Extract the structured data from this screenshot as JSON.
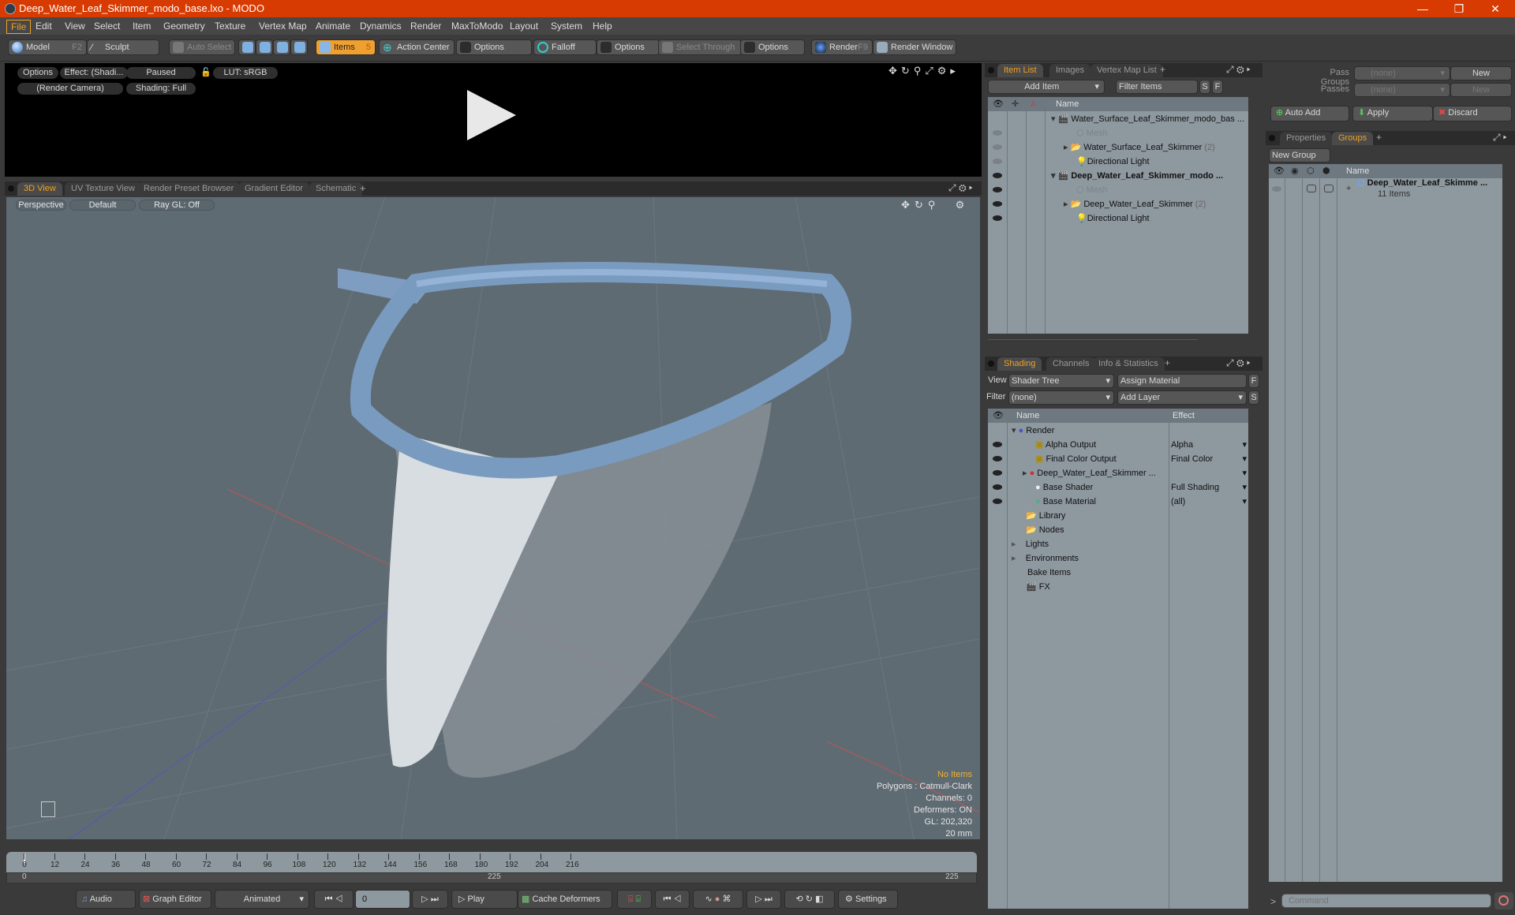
{
  "window": {
    "title": "Deep_Water_Leaf_Skimmer_modo_base.lxo - MODO",
    "minimize": "—",
    "restore": "❐",
    "close": "✕"
  },
  "menu": [
    "File",
    "Edit",
    "View",
    "Select",
    "Item",
    "Geometry",
    "Texture",
    "Vertex Map",
    "Animate",
    "Dynamics",
    "Render",
    "MaxToModo",
    "Layout",
    "System",
    "Help"
  ],
  "toolbar": {
    "model": "Model",
    "model_key": "F2",
    "sculpt": "Sculpt",
    "auto_select": "Auto Select",
    "items": "Items",
    "items_key": "5",
    "action_center": "Action Center",
    "options1": "Options",
    "falloff": "Falloff",
    "options2": "Options",
    "select_through": "Select Through",
    "options3": "Options",
    "render": "Render",
    "render_key": "F9",
    "render_window": "Render Window"
  },
  "render_preview": {
    "options": "Options",
    "effect": "Effect: (Shadi...",
    "paused": "Paused",
    "lut": "LUT: sRGB",
    "camera": "(Render Camera)",
    "shading": "Shading: Full"
  },
  "viewport_tabs": [
    "3D View",
    "UV Texture View",
    "Render Preset Browser",
    "Gradient Editor",
    "Schematic",
    "+"
  ],
  "viewport": {
    "perspective": "Perspective",
    "default": "Default",
    "raygl": "Ray GL: Off",
    "stats": {
      "no_items": "No Items",
      "polygons": "Polygons : Catmull-Clark",
      "channels": "Channels: 0",
      "deformers": "Deformers: ON",
      "gl": "GL: 202,320",
      "scale": "20 mm"
    }
  },
  "item_list": {
    "tabs": [
      "Item List",
      "Images",
      "Vertex Map List",
      "+"
    ],
    "add_item": "Add Item",
    "filter": "Filter Items",
    "s": "S",
    "f": "F",
    "name_header": "Name",
    "rows": [
      {
        "label": "Water_Surface_Leaf_Skimmer_modo_bas ...",
        "bold": false,
        "count": ""
      },
      {
        "label": "Mesh",
        "bold": false,
        "count": ""
      },
      {
        "label": "Water_Surface_Leaf_Skimmer",
        "bold": false,
        "count": "(2)"
      },
      {
        "label": "Directional Light",
        "bold": false,
        "count": ""
      },
      {
        "label": "Deep_Water_Leaf_Skimmer_modo ...",
        "bold": true,
        "count": ""
      },
      {
        "label": "Mesh",
        "bold": false,
        "count": ""
      },
      {
        "label": "Deep_Water_Leaf_Skimmer",
        "bold": false,
        "count": "(2)"
      },
      {
        "label": "Directional Light",
        "bold": false,
        "count": ""
      }
    ]
  },
  "shading": {
    "tabs": [
      "Shading",
      "Channels",
      "Info & Statistics",
      "+"
    ],
    "view_label": "View",
    "view_value": "Shader Tree",
    "assign_material": "Assign Material",
    "f": "F",
    "filter_label": "Filter",
    "filter_value": "(none)",
    "add_layer": "Add Layer",
    "s": "S",
    "name_header": "Name",
    "effect_header": "Effect",
    "rows": [
      {
        "label": "Render",
        "effect": ""
      },
      {
        "label": "Alpha Output",
        "effect": "Alpha"
      },
      {
        "label": "Final Color Output",
        "effect": "Final Color"
      },
      {
        "label": "Deep_Water_Leaf_Skimmer ...",
        "effect": ""
      },
      {
        "label": "Base Shader",
        "effect": "Full Shading"
      },
      {
        "label": "Base Material",
        "effect": "(all)"
      },
      {
        "label": "Library",
        "effect": ""
      },
      {
        "label": "Nodes",
        "effect": ""
      },
      {
        "label": "Lights",
        "effect": ""
      },
      {
        "label": "Environments",
        "effect": ""
      },
      {
        "label": "Bake Items",
        "effect": ""
      },
      {
        "label": "FX",
        "effect": ""
      }
    ]
  },
  "passes": {
    "pass_groups_label": "Pass Groups",
    "pass_groups_value": "(none)",
    "new1": "New",
    "passes_label": "Passes",
    "passes_value": "(none)",
    "new2": "New",
    "auto_add": "Auto Add",
    "apply": "Apply",
    "discard": "Discard"
  },
  "groups": {
    "tabs": [
      "Properties",
      "Groups",
      "+"
    ],
    "new_group": "New Group",
    "name_header": "Name",
    "group_name": "Deep_Water_Leaf_Skimme ...",
    "group_count": "11 Items"
  },
  "timeline": {
    "ticks": [
      "0",
      "12",
      "24",
      "36",
      "48",
      "60",
      "72",
      "84",
      "96",
      "108",
      "120",
      "132",
      "144",
      "156",
      "168",
      "180",
      "192",
      "204",
      "216"
    ],
    "range_start": "0",
    "range_mid": "225",
    "range_end": "225"
  },
  "bottom": {
    "audio": "Audio",
    "graph_editor": "Graph Editor",
    "animated": "Animated",
    "frame": "0",
    "play": "Play",
    "cache_deformers": "Cache Deformers",
    "settings": "Settings"
  },
  "command": {
    "placeholder": "Command",
    "prompt": ">"
  }
}
